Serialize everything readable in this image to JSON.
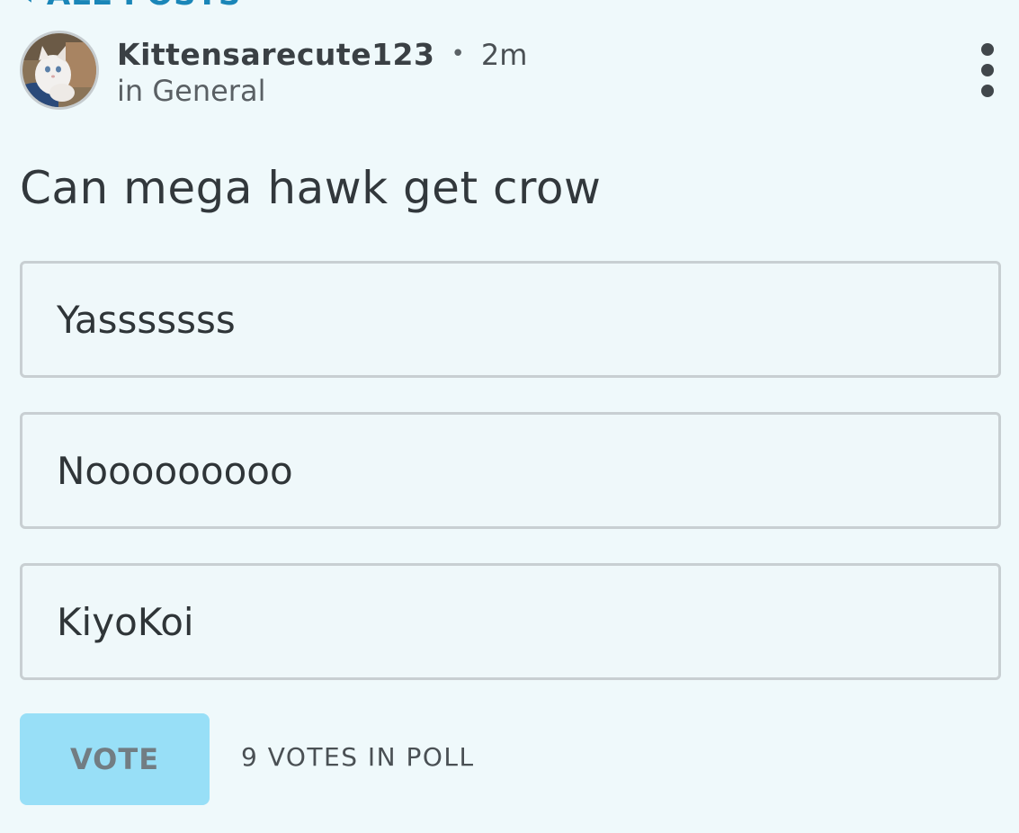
{
  "back_link": {
    "icon": "chevron-left-icon",
    "label": "ALL POSTS",
    "color": "#1a86b8"
  },
  "post": {
    "author": "Kittensarecute123",
    "separator": "•",
    "time": "2m",
    "category": "in General",
    "more_icon": "vertical-dots-icon"
  },
  "poll": {
    "question": "Can mega hawk get crow",
    "options": [
      {
        "label": "Yasssssss"
      },
      {
        "label": "Nooooooooo"
      },
      {
        "label": "KiyoKoi"
      }
    ],
    "vote_button_label": "VOTE",
    "vote_count_text": "9 VOTES IN POLL"
  },
  "colors": {
    "background": "#eff9fb",
    "vote_button_bg": "#98dff7",
    "option_border": "#c8cfd2"
  }
}
